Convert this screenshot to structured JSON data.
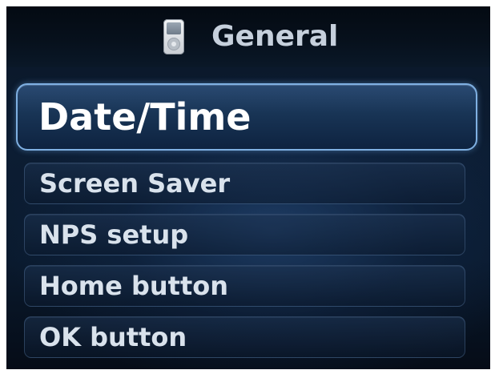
{
  "header": {
    "title": "General",
    "icon": "ipod-icon"
  },
  "menu": {
    "selected_index": 0,
    "items": [
      {
        "label": "Date/Time"
      },
      {
        "label": "Screen Saver"
      },
      {
        "label": "NPS setup"
      },
      {
        "label": "Home button"
      },
      {
        "label": "OK button"
      }
    ]
  },
  "colors": {
    "highlight_border": "#7fb0e2",
    "text": "#d9e2ec",
    "header_text": "#c6d0dc",
    "background": "#0c1d33"
  }
}
